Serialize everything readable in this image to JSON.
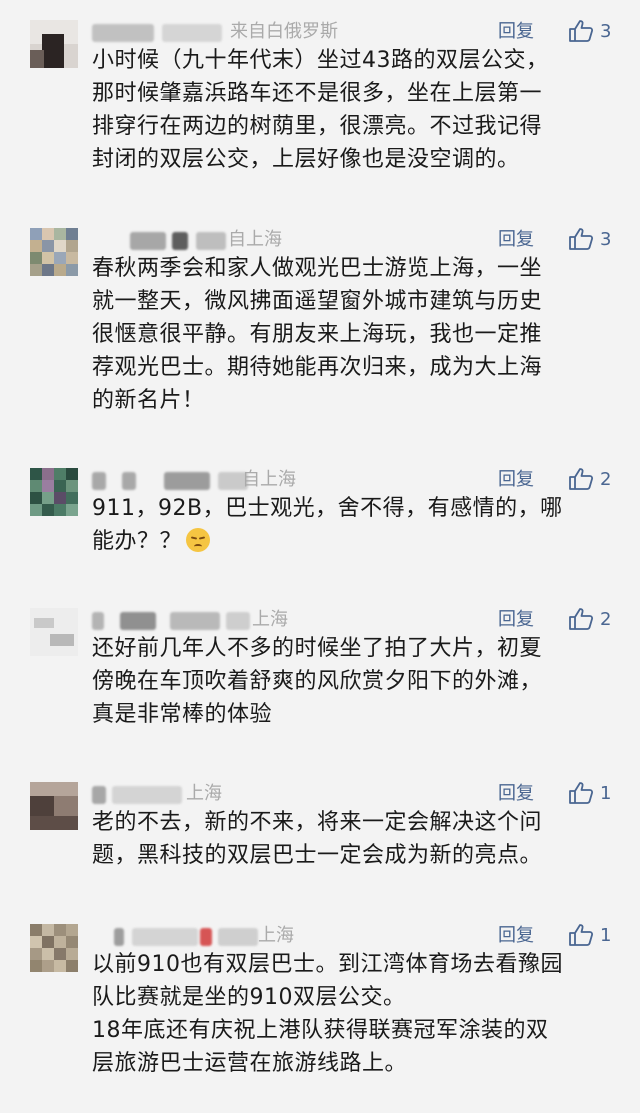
{
  "reply_label": "回复",
  "comments": [
    {
      "location": "来自白俄罗斯",
      "likes": "3",
      "lines": [
        "小时候（九十年代末）坐过43路的双层公交，",
        "那时候肇嘉浜路车还不是很多，坐在上层第一",
        "排穿行在两边的树荫里，很漂亮。不过我记得",
        "封闭的双层公交，上层好像也是没空调的。"
      ]
    },
    {
      "location": "自上海",
      "likes": "3",
      "lines": [
        "春秋两季会和家人做观光巴士游览上海，一坐",
        "就一整天，微风拂面遥望窗外城市建筑与历史",
        "很惬意很平静。有朋友来上海玩，我也一定推",
        "荐观光巴士。期待她能再次归来，成为大上海",
        "的新名片！"
      ]
    },
    {
      "location": "自上海",
      "likes": "2",
      "lines": [
        "911，92B，巴士观光，舍不得，有感情的，哪",
        "能办？？"
      ],
      "emoji": "pensive-face"
    },
    {
      "location": "上海",
      "likes": "2",
      "lines": [
        "还好前几年人不多的时候坐了拍了大片，初夏",
        "傍晚在车顶吹着舒爽的风欣赏夕阳下的外滩，",
        "真是非常棒的体验"
      ]
    },
    {
      "location": "上海",
      "likes": "1",
      "lines": [
        "老的不去，新的不来，将来一定会解决这个问",
        "题，黑科技的双层巴士一定会成为新的亮点。"
      ]
    },
    {
      "location": "上海",
      "likes": "1",
      "lines": [
        "以前910也有双层巴士。到江湾体育场去看豫园",
        "队比赛就是坐的910双层公交。",
        "18年底还有庆祝上港队获得联赛冠军涂装的双",
        "层旅游巴士运营在旅游线路上。"
      ]
    }
  ]
}
